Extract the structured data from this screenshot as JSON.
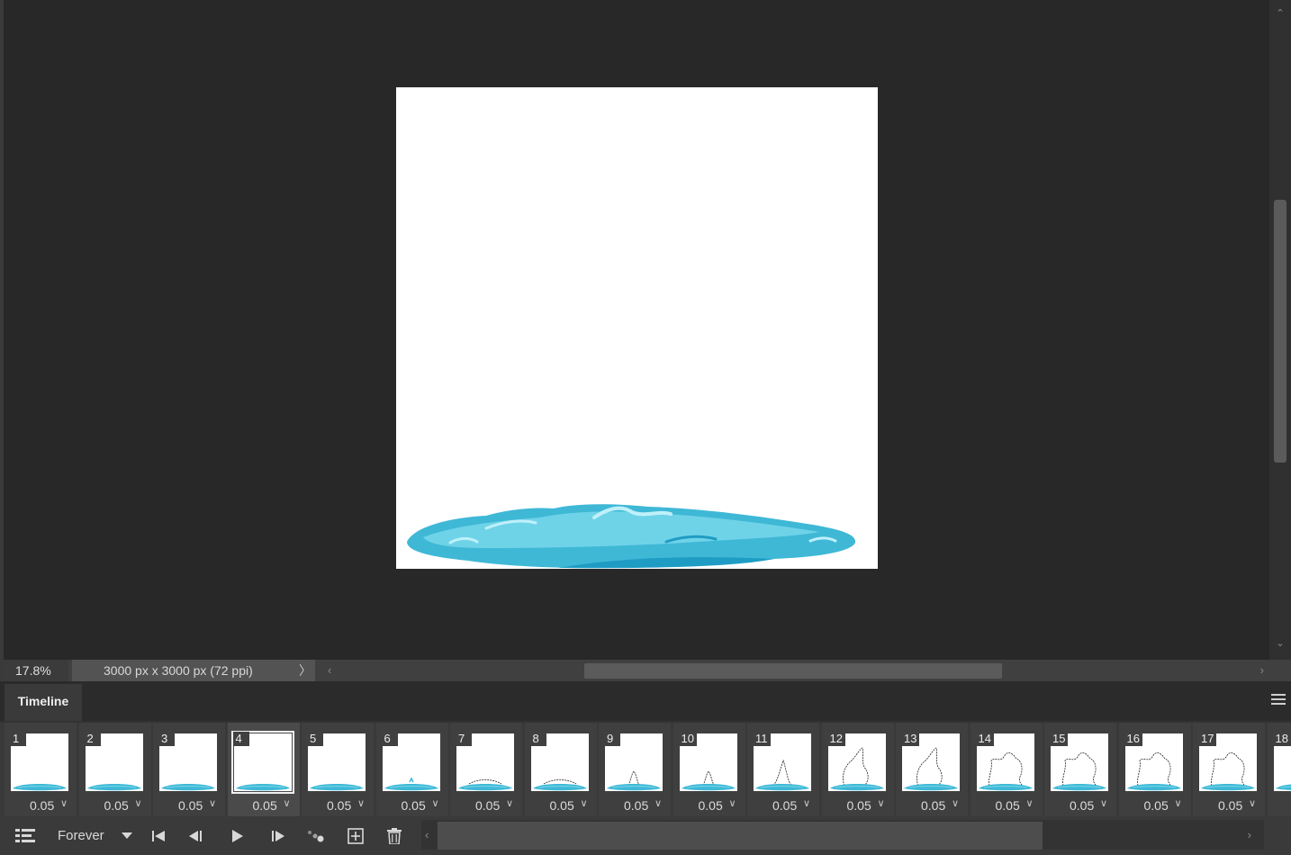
{
  "status": {
    "zoom": "17.8%",
    "doc_info": "3000 px x 3000 px (72 ppi)",
    "doc_info_chevron": "〉"
  },
  "panel": {
    "tab_label": "Timeline"
  },
  "frames": [
    {
      "num": "1",
      "dur": "0.05",
      "splash": "none"
    },
    {
      "num": "2",
      "dur": "0.05",
      "splash": "none"
    },
    {
      "num": "3",
      "dur": "0.05",
      "splash": "none"
    },
    {
      "num": "4",
      "dur": "0.05",
      "splash": "none",
      "selected": true
    },
    {
      "num": "5",
      "dur": "0.05",
      "splash": "none"
    },
    {
      "num": "6",
      "dur": "0.05",
      "splash": "tiny"
    },
    {
      "num": "7",
      "dur": "0.05",
      "splash": "ripple"
    },
    {
      "num": "8",
      "dur": "0.05",
      "splash": "ripple"
    },
    {
      "num": "9",
      "dur": "0.05",
      "splash": "spike"
    },
    {
      "num": "10",
      "dur": "0.05",
      "splash": "spike"
    },
    {
      "num": "11",
      "dur": "0.05",
      "splash": "spike-tall"
    },
    {
      "num": "12",
      "dur": "0.05",
      "splash": "crown"
    },
    {
      "num": "13",
      "dur": "0.05",
      "splash": "crown"
    },
    {
      "num": "14",
      "dur": "0.05",
      "splash": "crown-wide"
    },
    {
      "num": "15",
      "dur": "0.05",
      "splash": "crown-wide"
    },
    {
      "num": "16",
      "dur": "0.05",
      "splash": "crown-wide"
    },
    {
      "num": "17",
      "dur": "0.05",
      "splash": "crown-wide"
    },
    {
      "num": "18",
      "dur": "",
      "splash": "none"
    }
  ],
  "controls": {
    "loop_option": "Forever"
  },
  "colors": {
    "water_light": "#6fd3e8",
    "water_mid": "#3fb8d6",
    "water_dark": "#1f9cc4",
    "water_highlight": "#bff0fa"
  }
}
